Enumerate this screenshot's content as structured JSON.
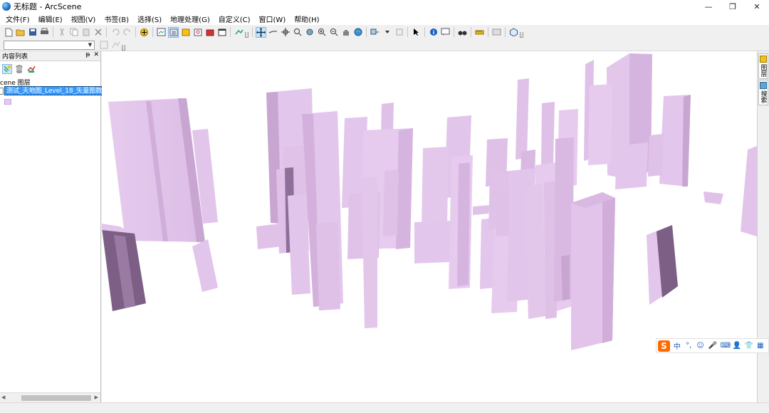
{
  "window": {
    "title": "无标题 - ArcScene",
    "minimize_glyph": "—",
    "restore_glyph": "❐",
    "close_glyph": "✕"
  },
  "menu": [
    {
      "label": "文件(F)"
    },
    {
      "label": "编辑(E)"
    },
    {
      "label": "视图(V)"
    },
    {
      "label": "书签(B)"
    },
    {
      "label": "选择(S)"
    },
    {
      "label": "地理处理(G)"
    },
    {
      "label": "自定义(C)"
    },
    {
      "label": "窗口(W)"
    },
    {
      "label": "帮助(H)"
    }
  ],
  "toc": {
    "title": "内容列表",
    "pin_glyph": "ᵽ",
    "close_glyph": "✕",
    "scene_label": "cene 图层",
    "layer_label": "测试_天地图_Level_18_矢量图数据",
    "symbol_color": "#e8c8f0"
  },
  "toolbar2": {
    "combo_value": ""
  },
  "right_dock": {
    "tab1": "图层",
    "tab2": "搜索"
  },
  "ime": {
    "logo": "S",
    "items": [
      "中",
      "°,",
      "☺",
      "🎤",
      "⌨",
      "👤",
      "👕",
      "▦"
    ]
  },
  "colors": {
    "building_front": "#e2c4ea",
    "building_side": "#c9a6d2",
    "building_dark": "#7d5f86",
    "building_top": "#d9b8e2",
    "selection": "#3399ff",
    "ime_logo": "#ff6a00"
  }
}
